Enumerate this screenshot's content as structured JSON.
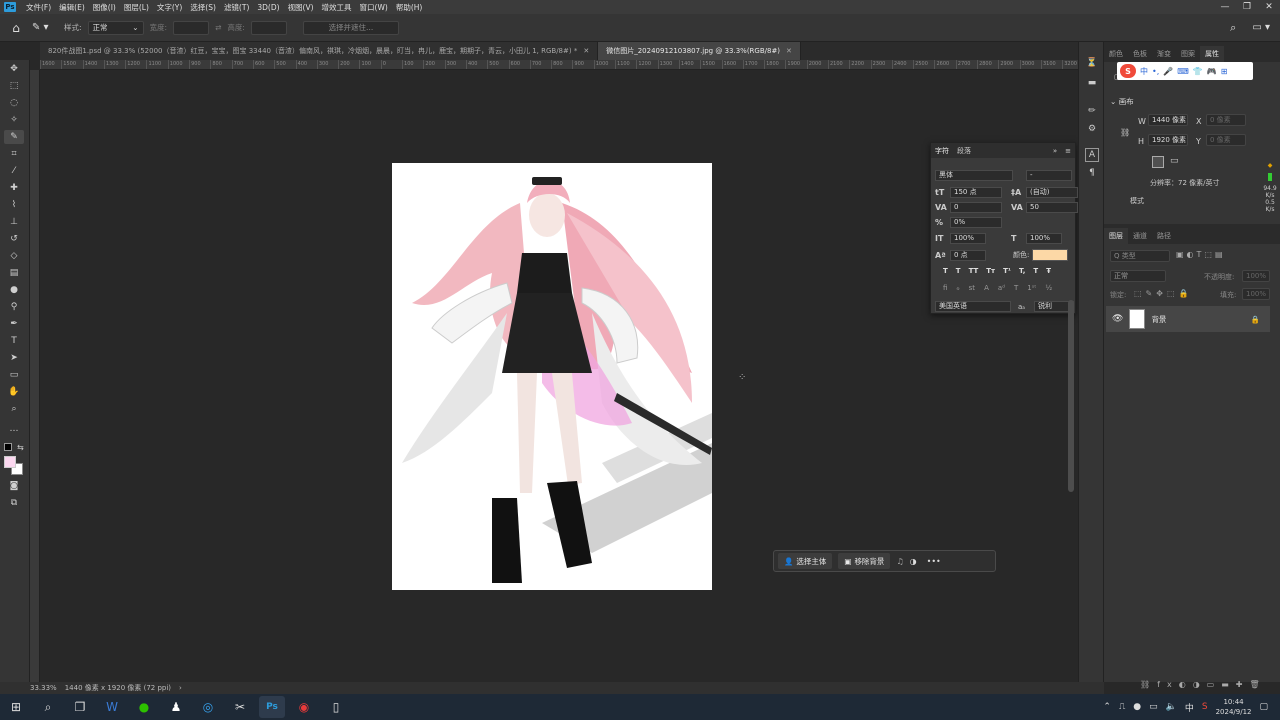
{
  "menu": {
    "logo": "Ps",
    "items": [
      "文件(F)",
      "编辑(E)",
      "图像(I)",
      "图层(L)",
      "文字(Y)",
      "选择(S)",
      "滤镜(T)",
      "3D(D)",
      "视图(V)",
      "增效工具",
      "窗口(W)",
      "帮助(H)"
    ],
    "win": [
      "—",
      "❐",
      "✕"
    ]
  },
  "options": {
    "style_label": "样式:",
    "style_value": "正常",
    "width_label": "宽度:",
    "height_label": "高度:",
    "select_mask_btn": "选择并遮住..."
  },
  "tabs": [
    {
      "label": "820件战图1.psd @ 33.3% (52000（音渣）红豆，宝宝，图宝 33440（音渣）偏南风，祺琪，冷烟烟，晨晨，盯当，冉儿，鹿宝，期期子，青云，小田儿 1, RGB/8#) *",
      "active": false
    },
    {
      "label": "微信图片_20240912103807.jpg @ 33.3%(RGB/8#)",
      "active": true
    }
  ],
  "ruler_ticks": [
    "1600",
    "1500",
    "1400",
    "1300",
    "1200",
    "1100",
    "1000",
    "900",
    "800",
    "700",
    "600",
    "500",
    "400",
    "300",
    "200",
    "100",
    "0",
    "100",
    "200",
    "300",
    "400",
    "500",
    "600",
    "700",
    "800",
    "900",
    "1000",
    "1100",
    "1200",
    "1300",
    "1400",
    "1500",
    "1600",
    "1700",
    "1800",
    "1900",
    "2000",
    "2100",
    "2200",
    "2300",
    "2400",
    "2500",
    "2600",
    "2700",
    "2800",
    "2900",
    "3000",
    "3100",
    "3200"
  ],
  "status": {
    "zoom": "33.33%",
    "dims": "1440 像素 x 1920 像素 (72 ppi)",
    "arrow": "›"
  },
  "right_panel": {
    "top_tabs": [
      "颜色",
      "色板",
      "渐变",
      "图案",
      "属性"
    ],
    "canvas_label": "文档",
    "section": "画布",
    "w_label": "W",
    "w_value": "1440 像素",
    "x_label": "X",
    "x_placeholder": "0 像素",
    "h_label": "H",
    "h_value": "1920 像素",
    "y_label": "Y",
    "y_placeholder": "0 像素",
    "resolution": "分辨率：72 像素/英寸",
    "mode_label": "模式",
    "layers_tabs": [
      "图层",
      "通道",
      "路径"
    ],
    "kind_placeholder": "Q 类型",
    "blend": "正常",
    "opacity_label": "不透明度:",
    "opacity_value": "100%",
    "lock_label": "锁定:",
    "fill_label": "填充:",
    "fill_value": "100%",
    "layer_name": "背景",
    "stats": [
      "94.9",
      "K/s",
      "0.5",
      "K/s"
    ]
  },
  "char_panel": {
    "tabs": [
      "字符",
      "段落"
    ],
    "font_family": "黑体",
    "font_style": "-",
    "size": "150 点",
    "leading": "(自动)",
    "kerning": "0",
    "tracking": "50",
    "scale_pct": "0%",
    "vscale": "100%",
    "hscale": "100%",
    "baseline": "0 点",
    "color_label": "颜色:",
    "color": "#fcd8a6",
    "lang": "美国英语",
    "aa_label": "aₐ",
    "aa": "锐利",
    "style_buttons": [
      "T",
      "T",
      "TT",
      "Tт",
      "T¹",
      "T,",
      "T",
      "Ŧ"
    ],
    "ot_buttons": [
      "fi",
      "ℴ",
      "st",
      "A",
      "aᵈ",
      "T",
      "1ˢᵗ",
      "½"
    ]
  },
  "context_bar": {
    "select_subject": "选择主体",
    "remove_bg": "移除背景"
  },
  "sogou": {
    "logo": "S",
    "items": [
      "中",
      "•,",
      "🎤",
      "⌨",
      "👕",
      "🎮",
      "⊞"
    ]
  },
  "taskbar": {
    "time": "10:44",
    "date": "2024/9/12",
    "ime": "中"
  }
}
